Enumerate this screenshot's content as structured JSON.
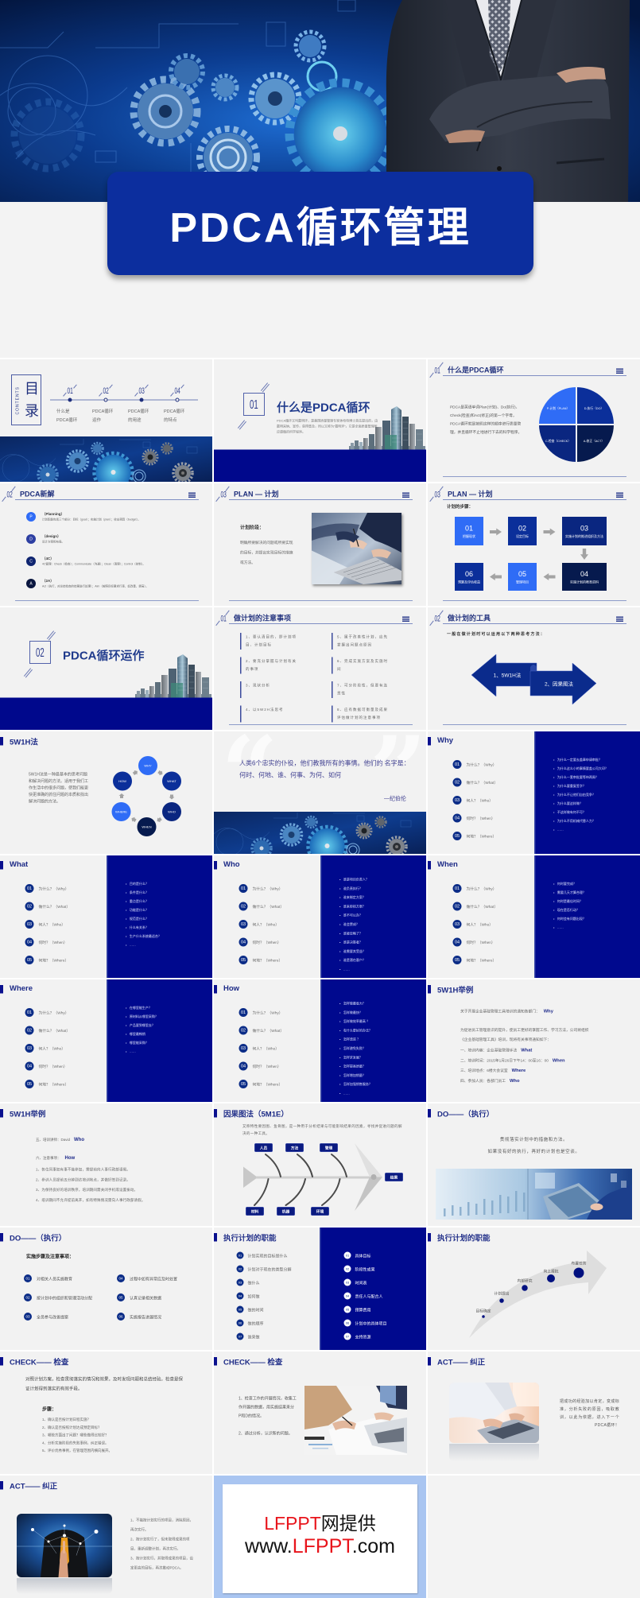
{
  "theme": {
    "navy": "#1e2e7a",
    "panel_blue": "#00098e",
    "band_blue": "#00088c",
    "bright_blue": "#2f6cf6",
    "royal_blue": "#0b2f9a",
    "dark_blue": "#0a2680",
    "deep_navy": "#061a4e",
    "badge_blue": "#0b2c87",
    "title_box": "#0c2e9e",
    "arrow_grey": "#a3a3a3",
    "watermark_red": "#e8141b",
    "watermark_border": "#a9c5f1"
  },
  "cover": {
    "title": "PDCA循环管理"
  },
  "w5h1_menu": [
    {
      "num": "01",
      "label": "为什么？（Why）"
    },
    {
      "num": "02",
      "label": "做什么？（What）"
    },
    {
      "num": "03",
      "label": "何人？（Who）"
    },
    {
      "num": "04",
      "label": "何时？（When）"
    },
    {
      "num": "05",
      "label": "何地？（Where）"
    }
  ],
  "s01": {
    "contents_en": "CONTENTS",
    "contents_cn_1": "目",
    "contents_cn_2": "录",
    "items": [
      {
        "num": "01",
        "line1": "什么是",
        "line2": "PDCA循环"
      },
      {
        "num": "02",
        "line1": "PDCA循环",
        "line2": "运作"
      },
      {
        "num": "03",
        "line1": "PDCA循环",
        "line2": "的用途"
      },
      {
        "num": "04",
        "line1": "PDCA循环",
        "line2": "的特点"
      }
    ]
  },
  "s02": {
    "num": "01",
    "title": "什么是PDCA循环",
    "desc": "PDCA循环又叫戴明环，是美国质量管理专家休哈特博士首先提出的，由戴明采纳、宣传，获得普及，所以又称为“戴明环”。它是全面质量管理所应遵循的科学程序。"
  },
  "s03": {
    "num": "01",
    "title": "什么是PDCA循环",
    "text": "PDCA是英语单词Plan(计划)、Do(执行)、Check(检查)和Act(修正)的第一个字母，PDCA循环就是按照这样的顺序进行质量管理，并且循环不止地进行下去的科学程序。",
    "quadrants": [
      "P-计划（PLAN）",
      "D-执行（DO）",
      "C-检查（CHECK）",
      "A-修正（ACT）"
    ]
  },
  "s04": {
    "num": "02",
    "title": "PDCA新解",
    "items": [
      {
        "letter": "P",
        "title": "（Planning）",
        "desc": "计划职能包括三个部分：目标（goal）；实施计划（plan）；收支预算（budget）。"
      },
      {
        "letter": "D",
        "title": "（design）",
        "desc": "设计方案和布局。"
      },
      {
        "letter": "C",
        "title": "（4C）",
        "desc": "4C管理：Check（检查）；Communicate（沟通）；Clean（清理）；Control（控制）。"
      },
      {
        "letter": "A",
        "title": "（2A）",
        "desc": "Act（执行，对总结检查的结果进行处理）；Aim（按照目标要求行事，如改善、提高）。"
      }
    ]
  },
  "s05": {
    "num": "03",
    "title": "PLAN — 计划",
    "subtitle": "计划阶段：",
    "text": "明确所要解决的问题或所要实现的目标，并提出实现目标的措施或方法。"
  },
  "s06": {
    "num": "03",
    "title": "PLAN — 计划",
    "subtitle": "计划的步骤：",
    "steps": [
      {
        "num": "01",
        "label": "把握现状"
      },
      {
        "num": "02",
        "label": "设定目标"
      },
      {
        "num": "03",
        "label": "实施计划的推进组织及方法"
      },
      {
        "num": "04",
        "label": "实施计划的教育资料"
      },
      {
        "num": "05",
        "label": "管理项目"
      },
      {
        "num": "06",
        "label": "预算及评估收益"
      }
    ]
  },
  "s07": {
    "num": "02",
    "title": "PDCA循环运作"
  },
  "s08": {
    "num": "01",
    "title": "做计划的注意事项",
    "items": [
      "1、要认清目的，即计划项目、计划目标",
      "2、要充分掌握与计划有关的事项",
      "3、现状分析",
      "4、以5W2H法思考",
      "5、属于改善性计划，应先掌握出问题点原因",
      "6、完成实施方案及实施时间",
      "7、可分阶段性，但要有连贯性",
      "8、应有数据可衡量及成果评估做计划的注意事项"
    ]
  },
  "s09": {
    "num": "02",
    "title": "做计划的工具",
    "subtitle": "一般在做计划时可以运用以下两种思考方法：",
    "left": "1、5W1H法",
    "right": "2、因果图法"
  },
  "s10": {
    "title": "5W1H法",
    "text": "5W1H法是一种最基本的思考问题和解决问题的方法。适用于我们工作生活中的很多问题，使我们能更快更准确的抓住问题的本质和找出解决问题的方法。",
    "nodes": [
      "WHY",
      "WHAT",
      "WHO",
      "WHEN",
      "WHERE",
      "HOW"
    ]
  },
  "s11": {
    "open_quote": "“",
    "close_quote": "”",
    "quote": "人类6个忠实的仆役，他们教我所有的事情。他们的 名字是：何时、何地、谁、何事、为何、如何",
    "author": "—纪伯伦"
  },
  "s12": {
    "title": "Why",
    "bullets": [
      "为什么一定要去盖章申请审批？",
      "为什么这么小的事情要盖公司大印？",
      "为什么一套审批要等待两周？",
      "为什么要重复签字？",
      "为什么不让他们自由竞争？",
      "为什么要这样做？",
      "不这样做有何不可？",
      "为什么不用机械代替人力？",
      "……"
    ]
  },
  "s13": {
    "title": "What",
    "bullets": [
      "目的是什么？",
      "条件是什么？",
      "重点是什么？",
      "功能是什么？",
      "规范是什么？",
      "什么有关系？",
      "生产什么系统最适合？",
      "……"
    ]
  },
  "s14": {
    "title": "Who",
    "bullets": [
      "谁是项目负责人？",
      "谁负责执行？",
      "谁来制定方案？",
      "谁来审核方案？",
      "谁不可以办？",
      "谁会赞成？",
      "谁被忽略了？",
      "谁是决策者？",
      "谁需要其受益？",
      "谁是潜在客户？",
      "……"
    ]
  },
  "s15": {
    "title": "When",
    "bullets": [
      "何时要完成？",
      "需要几天才算合理？",
      "何时是最佳时间？",
      "现在是否行动？",
      "何时会有问题出现？",
      "……"
    ]
  },
  "s16": {
    "title": "Where",
    "bullets": [
      "在哪里能生产？",
      "原材料从哪里采购？",
      "产品要到哪里去？",
      "哪里最畅销",
      "哪里能采购？",
      "……"
    ]
  },
  "s17": {
    "title": "How",
    "bullets": [
      "怎样做最省力？",
      "怎样做最快？",
      "怎样做效率最高 ？",
      "有什么更好的办法？",
      "怎样改进 ？",
      "怎样避免失败？",
      "怎样求发展？",
      "怎样提高质量？",
      "怎样增加销量？",
      "怎样加强销售服务？",
      "……"
    ]
  },
  "s18": {
    "title": "5W1H举例",
    "notice": {
      "text": "关于开展企业基础管理工具培训的通知各部门：",
      "key": "Why"
    },
    "intro_line1": "为促进员工管理意识的提升，使员工更好的掌握工作、学习方法，公司将组织",
    "intro_line2": "《企业基础管理工具》培训，现将有关事项通知如下：",
    "items": [
      {
        "text": "一、培训内容：企业基础管理手法",
        "key": "What"
      },
      {
        "text": "二、培训时间：2015年1月26日下午14：00至16：00",
        "key": "When"
      },
      {
        "text": "三、培训地点：6楼大会议室",
        "key": "Where"
      },
      {
        "text": "四、参加人员：各部门员工",
        "key": "Who"
      }
    ]
  },
  "s19": {
    "title": "5W1H举例",
    "trainer": {
      "text": "五、培训讲师：David",
      "key": "Who"
    },
    "notes_label": {
      "text": "六、注意事项：",
      "key": "How"
    },
    "notes": [
      "1、各位同事如有事不能参加，需提前向人事行政部请假。",
      "2、参训人员提前五分钟到达培训地点，并做好签到记录。",
      "3、为保持良好的培训秩序，培训期间需关闭手机或设置振动。",
      "4、培训期间不允许提前离开，如有特殊情况需向人事行政部请假。"
    ]
  },
  "s20": {
    "title": "因果图法（5M1E）",
    "desc": "又称特性要因图、鱼骨图，是一种用于分析结果与可能影响结果的因素，寻找并促进问题的解决的一种工具。",
    "top": [
      "人员",
      "方法",
      "管理"
    ],
    "bottom": [
      "材料",
      "机器",
      "环境"
    ],
    "result": "结果"
  },
  "s21": {
    "title": "DO——（执行）",
    "line1": "贯彻落实计划中的措施和方法。",
    "line2": "如果没有好的执行，再好的计划也是空谈。"
  },
  "s22": {
    "title": "DO——（执行）",
    "subtitle": "实施步骤及注意事项：",
    "items": [
      {
        "num": "01",
        "text": "对相关人员实施教育"
      },
      {
        "num": "02",
        "text": "按计划中的组织和管理活动分配"
      },
      {
        "num": "03",
        "text": "全员参与改善提案"
      },
      {
        "num": "04",
        "text": "过程中如有异常应及时处置"
      },
      {
        "num": "05",
        "text": "认真记录相关数据"
      },
      {
        "num": "06",
        "text": "实施报告进展情况"
      }
    ]
  },
  "s23": {
    "title": "执行计划的职能",
    "left": [
      {
        "num": "01",
        "text": "计划实现的目标是什么"
      },
      {
        "num": "02",
        "text": "计划对于现在的类型分解"
      },
      {
        "num": "03",
        "text": "做什么"
      },
      {
        "num": "04",
        "text": "如何做"
      },
      {
        "num": "05",
        "text": "做的时间"
      },
      {
        "num": "06",
        "text": "做的顺序"
      },
      {
        "num": "07",
        "text": "谁来做"
      }
    ],
    "right": [
      {
        "num": "01",
        "text": "具体目标"
      },
      {
        "num": "02",
        "text": "阶段性成果"
      },
      {
        "num": "03",
        "text": "时间表"
      },
      {
        "num": "04",
        "text": "责任人与配合人"
      },
      {
        "num": "05",
        "text": "预算费用"
      },
      {
        "num": "06",
        "text": "计划中的具体项目"
      },
      {
        "num": "07",
        "text": "支持资源"
      }
    ]
  },
  "s24": {
    "title": "执行计划的职能",
    "stages": [
      "目标确定",
      "计划提出",
      "内部研究",
      "向上报批",
      "布置任务"
    ]
  },
  "s25": {
    "title": "CHECK—— 检查",
    "text": "对照计划方案，检查贯彻落实的情况和效果，及时发现问题和总结经验。检查是保证计划得到落实的有效手段。",
    "steps_label": "步骤：",
    "steps": [
      "1、确认是否按计划日程实施？",
      "2、确认是否按照计划达成预定目标？",
      "3、哪些方面出了问题？哪些做得比较好？",
      "4、分析实施阶段的失败事例，纠正错误。",
      "5、评价优秀事例，在管理范围内横向展开。"
    ]
  },
  "s26": {
    "title": "CHECK—— 检查",
    "points": [
      "1、检查工作的开展情况，收集工作开展的数据，用实施结果来分P和D的情况。",
      "2、通过分析，认识新的问题。"
    ]
  },
  "s27": {
    "title": "ACT—— 纠正",
    "text": "把成功的经验加以肯定，变成标准，分析失败的原因，吸取教训，以此为依据，进入下一个PDCA循环！"
  },
  "s28": {
    "title": "ACT—— 纠正",
    "points": [
      "1、不能按计划实行的项目，消除原因，再次实行。",
      "2、按计划实行了，但未取得成果的项目，重新调整计划，再次实行。",
      "3、按计划实行，并取得成果的项目，设定更高的目标，再次推动PDCA。"
    ]
  },
  "s29": {
    "line1_red": "LFPPT",
    "line1_black": "网提供",
    "line2_prefix": "www.",
    "line2_red": "LFPPT",
    "line2_suffix": ".com"
  }
}
